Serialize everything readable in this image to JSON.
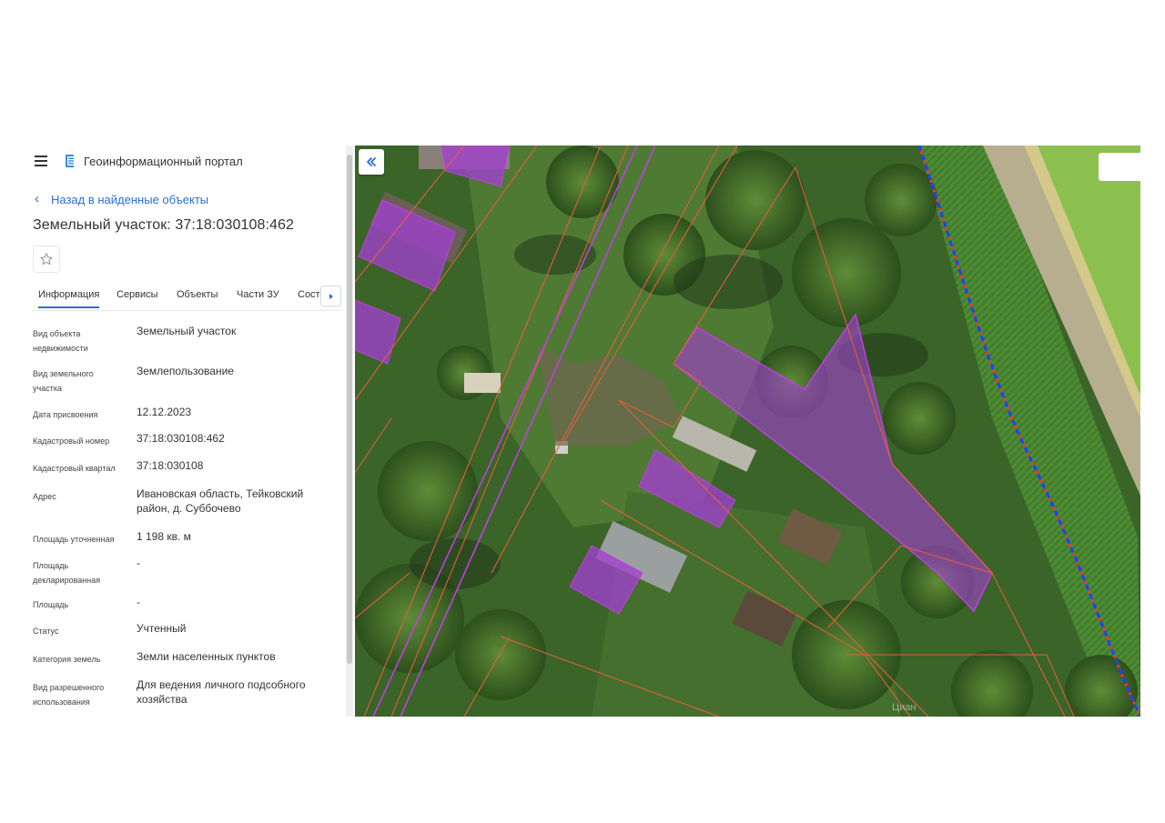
{
  "header": {
    "portal_title": "Геоинформационный портал"
  },
  "navigation": {
    "back_label": "Назад в найденные объекты"
  },
  "object": {
    "title": "Земельный участок: 37:18:030108:462"
  },
  "tabs": [
    {
      "label": "Информация",
      "active": true
    },
    {
      "label": "Сервисы",
      "active": false
    },
    {
      "label": "Объекты",
      "active": false
    },
    {
      "label": "Части ЗУ",
      "active": false
    },
    {
      "label": "Состав",
      "active": false
    }
  ],
  "properties": [
    {
      "key": "Вид объекта недвижимости",
      "value": "Земельный участок"
    },
    {
      "key": "Вид земельного участка",
      "value": "Землепользование"
    },
    {
      "key": "Дата присвоения",
      "value": "12.12.2023"
    },
    {
      "key": "Кадастровый номер",
      "value": "37:18:030108:462"
    },
    {
      "key": "Кадастровый квартал",
      "value": "37:18:030108"
    },
    {
      "key": "Адрес",
      "value": "Ивановская область, Тейковский район, д. Суббочево"
    },
    {
      "key": "Площадь уточненная",
      "value": "1 198 кв. м"
    },
    {
      "key": "Площадь декларированная",
      "value": "-"
    },
    {
      "key": "Площадь",
      "value": "-"
    },
    {
      "key": "Статус",
      "value": "Учтенный"
    },
    {
      "key": "Категория земель",
      "value": "Земли населенных пунктов"
    },
    {
      "key": "Вид разрешенного использования",
      "value": "Для ведения личного подсобного хозяйства"
    }
  ],
  "icons": {
    "menu": "hamburger-menu-icon",
    "logo": "portal-logo-icon",
    "back": "chevron-left-icon",
    "favorite": "star-outline-icon",
    "tabs_next": "caret-right-icon",
    "map_collapse": "double-chevron-left-icon"
  },
  "colors": {
    "accent": "#2a6fd6",
    "parcel_fill": "#a23fd0",
    "parcel_border": "#c040e0",
    "cadastral_lines": "#e0603a",
    "boundary_dashed": "#2040ff"
  },
  "map": {
    "watermark": "Циан"
  }
}
